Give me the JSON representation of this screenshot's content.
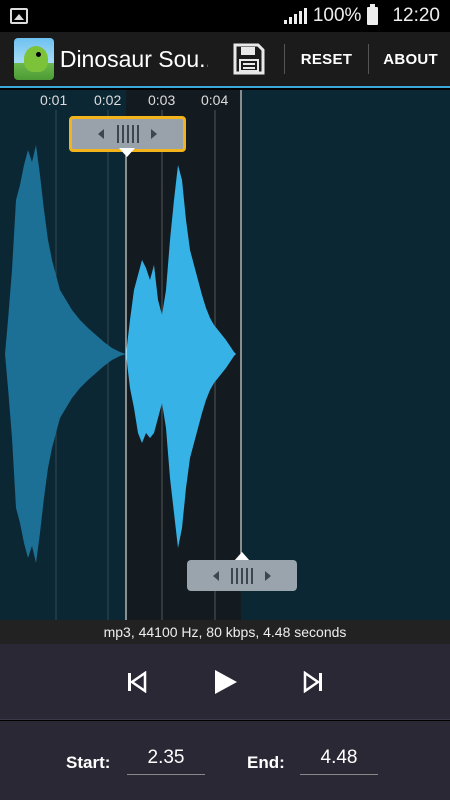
{
  "status_bar": {
    "battery": "100%",
    "time": "12:20"
  },
  "action_bar": {
    "title": "Dinosaur Sou...",
    "reset_label": "RESET",
    "about_label": "ABOUT"
  },
  "waveform": {
    "time_markers": [
      "0:01",
      "0:02",
      "0:03",
      "0:04"
    ],
    "selection_start": 2.35,
    "selection_end": 4.48,
    "colors": {
      "wave_unselected": "#1c6f95",
      "wave_selected": "#36b2e6",
      "handle_active_border": "#f3b41b"
    }
  },
  "info_text": "mp3, 44100 Hz, 80 kbps, 4.48 seconds",
  "controls": {
    "prev": "skip-previous-icon",
    "play": "play-icon",
    "next": "skip-next-icon"
  },
  "footer": {
    "start_label": "Start:",
    "start_value": "2.35",
    "end_label": "End:",
    "end_value": "4.48"
  }
}
